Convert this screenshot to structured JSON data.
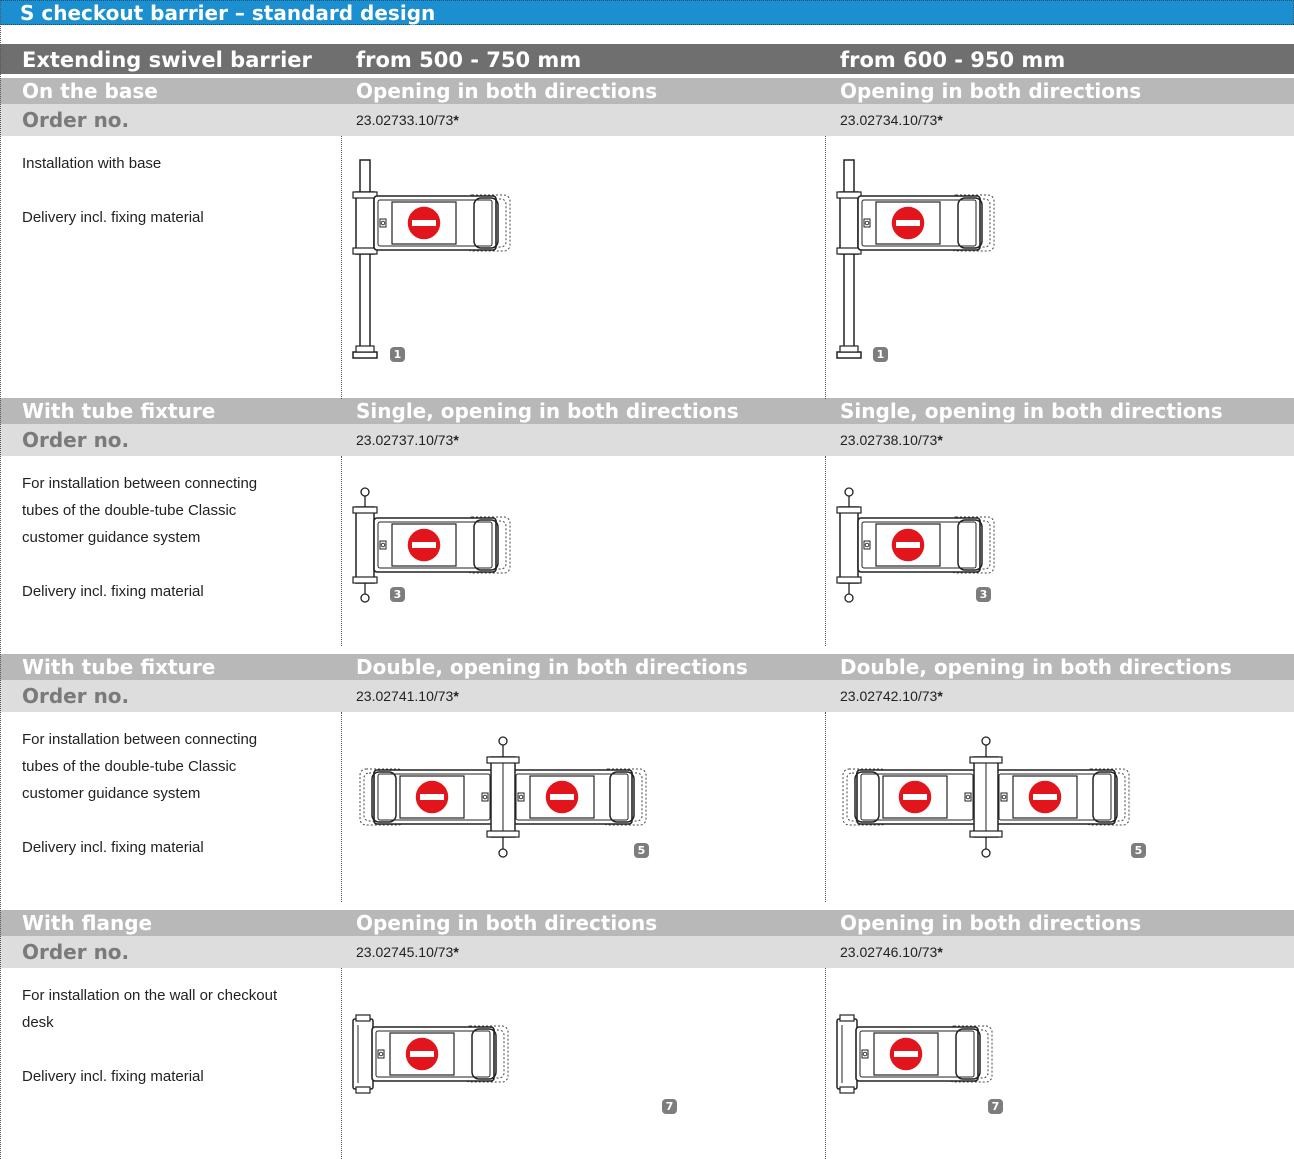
{
  "title": "S checkout barrier – standard design",
  "header": {
    "col1": "Extending swivel barrier",
    "col2": "from 500 - 750 mm",
    "col3": "from 600 - 950 mm"
  },
  "sections": [
    {
      "mount": "On the base",
      "opening_col2": "Opening in both directions",
      "opening_col3": "Opening in both directions",
      "order_label": "Order no.",
      "order_col2": "23.02733.10/73",
      "order_col3": "23.02734.10/73",
      "asterisk": "*",
      "description": [
        "Installation with base",
        "",
        "Delivery incl. fixing material"
      ],
      "badge": "1",
      "drawing": "barrier-on-base-drawing"
    },
    {
      "mount": "With tube fixture",
      "opening_col2": "Single, opening in both directions",
      "opening_col3": "Single, opening in both directions",
      "order_label": "Order no.",
      "order_col2": "23.02737.10/73",
      "order_col3": "23.02738.10/73",
      "asterisk": "*",
      "description": [
        "For installation between connecting",
        "tubes of the double-tube Classic",
        "customer guidance system",
        "",
        "Delivery incl. fixing material"
      ],
      "badge": "3",
      "drawing": "barrier-single-tube-fixture-drawing"
    },
    {
      "mount": "With tube fixture",
      "opening_col2": "Double, opening in both directions",
      "opening_col3": "Double, opening in both directions",
      "order_label": "Order no.",
      "order_col2": "23.02741.10/73",
      "order_col3": "23.02742.10/73",
      "asterisk": "*",
      "description": [
        "For installation between connecting",
        "tubes of the double-tube Classic",
        "customer guidance system",
        "",
        "Delivery incl. fixing material"
      ],
      "badge": "5",
      "drawing": "barrier-double-tube-fixture-drawing"
    },
    {
      "mount": "With flange",
      "opening_col2": "Opening in both directions",
      "opening_col3": "Opening in both directions",
      "order_label": "Order no.",
      "order_col2": "23.02745.10/73",
      "order_col3": "23.02746.10/73",
      "asterisk": "*",
      "description": [
        "For installation on the wall or checkout",
        "desk",
        "",
        "Delivery incl. fixing material"
      ],
      "badge": "7",
      "drawing": "barrier-flange-drawing"
    }
  ],
  "colors": {
    "title_band": "#1b8fcf",
    "header_band": "#6f6f6f",
    "section_band": "#b8b8b8",
    "order_band": "#dddddd",
    "no_entry_sign": "#e2151c"
  }
}
